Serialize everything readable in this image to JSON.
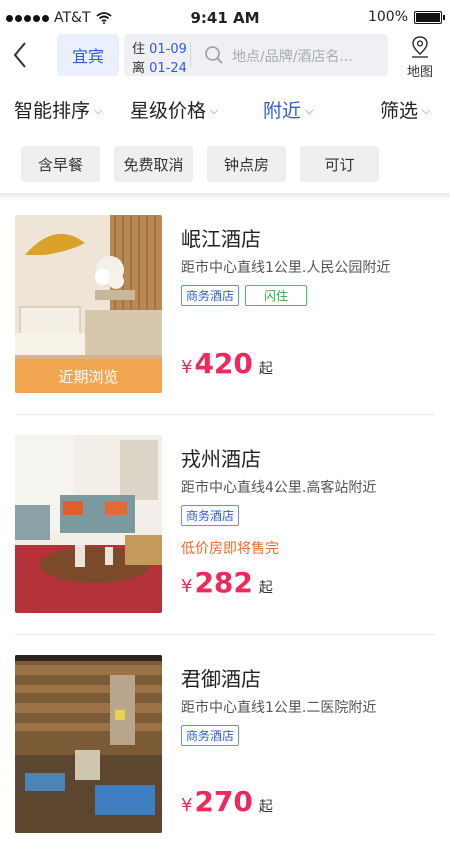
{
  "status_bar": {
    "carrier": "AT&T",
    "time": "9:41 AM",
    "battery": "100%",
    "battery_level": 1.0
  },
  "header": {
    "city": "宜宾",
    "checkin_label": "住",
    "checkin_date": "01-09",
    "checkout_label": "离",
    "checkout_date": "01-24",
    "search_placeholder": "地点/品牌/酒店名...",
    "map_label": "地图"
  },
  "filters": [
    {
      "label": "智能排序",
      "active": false
    },
    {
      "label": "星级价格",
      "active": false
    },
    {
      "label": "附近",
      "active": true
    },
    {
      "label": "筛选",
      "active": false
    }
  ],
  "quick_chips": [
    "含早餐",
    "免费取消",
    "钟点房",
    "可订"
  ],
  "hotels": [
    {
      "name": "岷江酒店",
      "distance": "距市中心直线1公里.人民公园附近",
      "tags": [
        "商务酒店",
        "闪住"
      ],
      "promo": "",
      "currency": "¥",
      "price": "420",
      "price_suffix": "起",
      "badge": "近期浏览"
    },
    {
      "name": "戎州酒店",
      "distance": "距市中心直线4公里.高客站附近",
      "tags": [
        "商务酒店"
      ],
      "promo": "低价房即将售完",
      "currency": "¥",
      "price": "282",
      "price_suffix": "起",
      "badge": ""
    },
    {
      "name": "君御酒店",
      "distance": "距市中心直线1公里.二医院附近",
      "tags": [
        "商务酒店"
      ],
      "promo": "",
      "currency": "¥",
      "price": "270",
      "price_suffix": "起",
      "badge": ""
    }
  ],
  "colors": {
    "accent": "#2f5bd8",
    "price": "#f0285b",
    "badge": "#f2a652",
    "promo": "#f06a2a"
  }
}
